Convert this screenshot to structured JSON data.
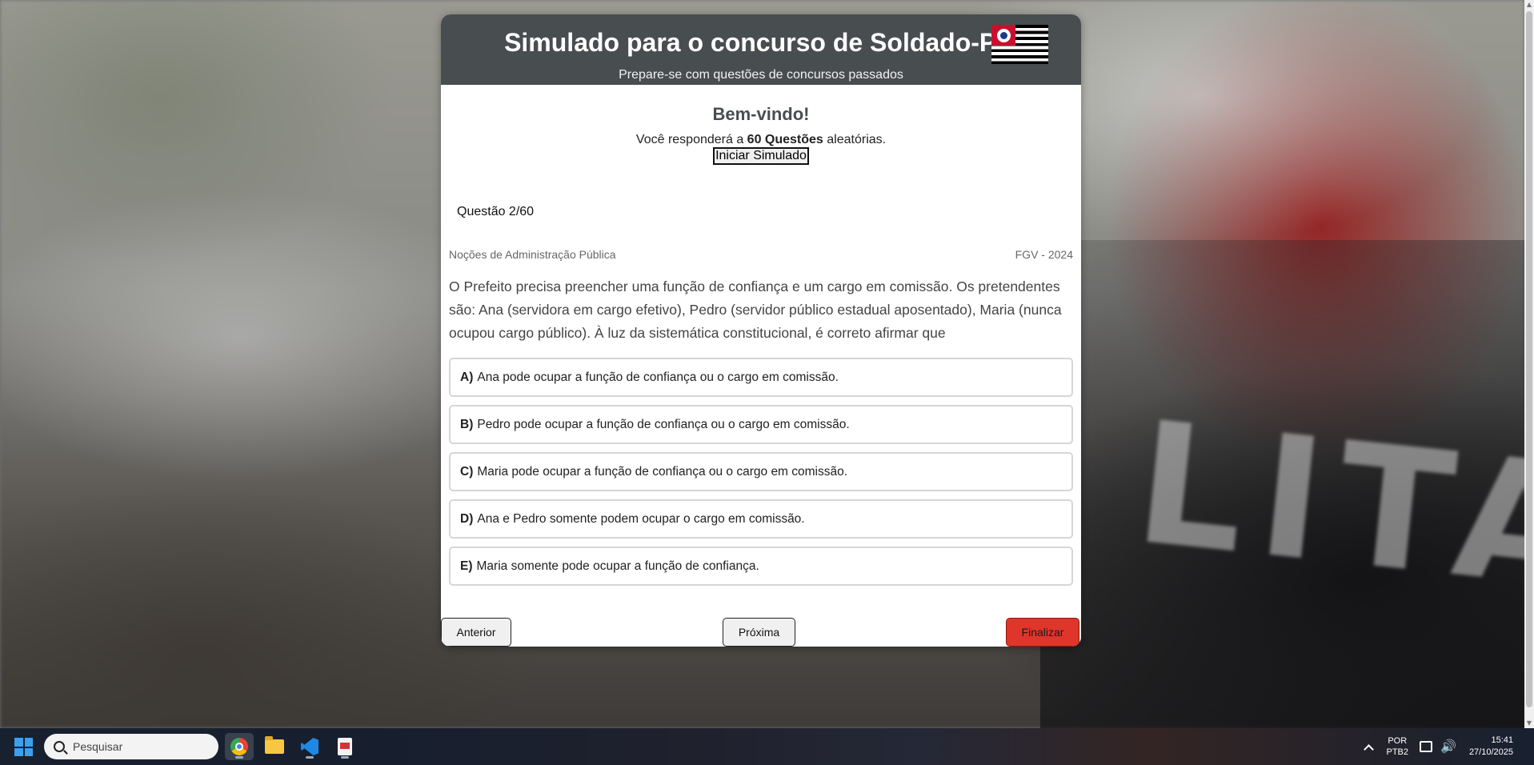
{
  "header": {
    "title": "Simulado para o concurso de Soldado-PM",
    "subtitle": "Prepare-se com questões de concursos passados"
  },
  "welcome": {
    "title": "Bem-vindo!",
    "text_before": "Você responderá a ",
    "text_bold": "60 Questões",
    "text_after": " aleatórias.",
    "start_button": "Iniciar Simulado"
  },
  "question": {
    "counter": "Questão 2/60",
    "subject": "Noções de Administração Pública",
    "source": "FGV - 2024",
    "text": "O Prefeito precisa preencher uma função de confiança e um cargo em comissão. Os pretendentes são: Ana (servidora em cargo efetivo), Pedro (servidor público estadual aposentado), Maria (nunca ocupou cargo público). À luz da sistemática constitucional, é correto afirmar que",
    "options": [
      {
        "letter": "A)",
        "text": "Ana pode ocupar a função de confiança ou o cargo em comissão."
      },
      {
        "letter": "B)",
        "text": "Pedro pode ocupar a função de confiança ou o cargo em comissão."
      },
      {
        "letter": "C)",
        "text": "Maria pode ocupar a função de confiança ou o cargo em comissão."
      },
      {
        "letter": "D)",
        "text": "Ana e Pedro somente podem ocupar o cargo em comissão."
      },
      {
        "letter": "E)",
        "text": "Maria somente pode ocupar a função de confiança."
      }
    ]
  },
  "nav": {
    "prev": "Anterior",
    "next": "Próxima",
    "finish": "Finalizar"
  },
  "background": {
    "letters": "LITAR"
  },
  "taskbar": {
    "search_placeholder": "Pesquisar",
    "lang_line1": "POR",
    "lang_line2": "PTB2",
    "time": "15:41",
    "date": "27/10/2025",
    "apps": [
      "chrome-icon",
      "file-explorer-icon",
      "vscode-icon",
      "document-app-icon"
    ]
  },
  "colors": {
    "header_bg": "#484d50",
    "finish_button": "#e0352b"
  }
}
